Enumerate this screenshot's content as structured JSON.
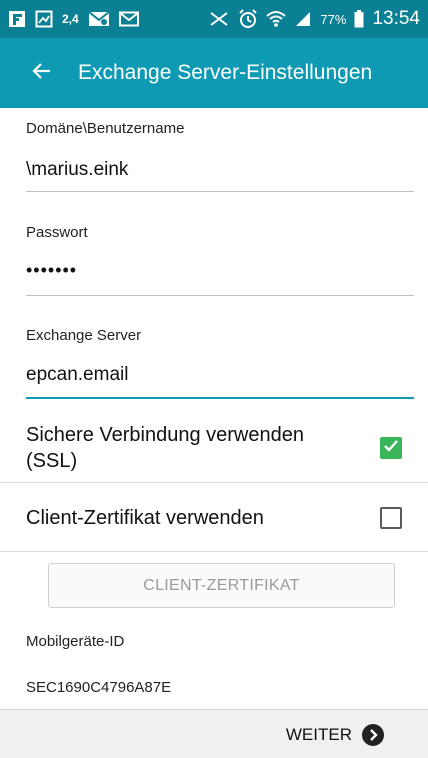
{
  "status_bar": {
    "network_speed": "2,4",
    "battery_percent": "77%",
    "time": "13:54",
    "icons": [
      "flipboard-icon",
      "gallery-icon",
      "network-speed-icon",
      "email-notification-icon",
      "mail-icon",
      "nfc-icon",
      "alarm-icon",
      "wifi-icon",
      "signal-icon",
      "battery-icon"
    ]
  },
  "app_bar": {
    "title": "Exchange Server-Einstellungen",
    "back_icon": "arrow-left-icon"
  },
  "fields": {
    "username": {
      "label": "Domäne\\Benutzername",
      "value": "\\marius.eink"
    },
    "password": {
      "label": "Passwort",
      "value": "•••••••"
    },
    "server": {
      "label": "Exchange Server",
      "value": "epcan.email"
    }
  },
  "settings": {
    "ssl": {
      "label": "Sichere Verbindung verwenden (SSL)",
      "checked": true
    },
    "client_cert": {
      "label": "Client-Zertifikat verwenden",
      "checked": false
    }
  },
  "client_cert_button": {
    "label": "CLIENT-ZERTIFIKAT"
  },
  "device_id": {
    "label": "Mobilgeräte-ID",
    "value": "SEC1690C4796A87E"
  },
  "footer": {
    "next_label": "WEITER"
  },
  "colors": {
    "status_bar": "#0b8094",
    "app_bar": "#0e9ab2",
    "checkbox_checked": "#3cb55a",
    "active_underline": "#0e9ab2"
  }
}
